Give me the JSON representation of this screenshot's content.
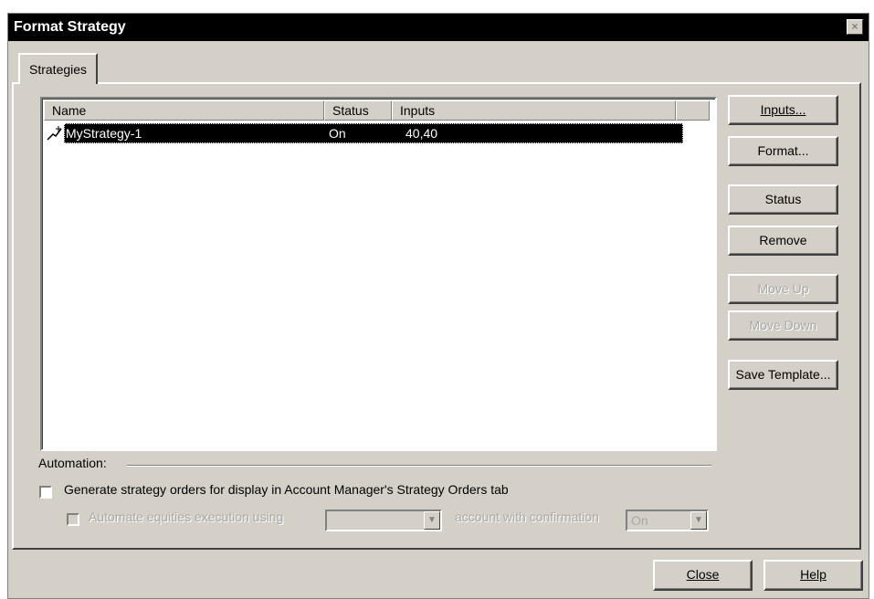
{
  "window": {
    "title": "Format Strategy",
    "close_glyph": "×"
  },
  "tabs": [
    {
      "label": "Strategies"
    }
  ],
  "list": {
    "columns": [
      "Name",
      "Status",
      "Inputs"
    ],
    "rows": [
      {
        "icon": "strategy-icon",
        "name": "MyStrategy-1",
        "status": "On",
        "inputs": "40,40"
      }
    ]
  },
  "buttons": {
    "inputs": "Inputs...",
    "format": "Format...",
    "status": "Status",
    "remove": "Remove",
    "move_up": "Move Up",
    "move_down": "Move Down",
    "save_template": "Save Template..."
  },
  "automation": {
    "label": "Automation:",
    "generate_orders": "Generate strategy orders for display in Account Manager's Strategy Orders tab",
    "automate_prefix": "Automate equities execution using",
    "account_select_value": "",
    "confirmation_text": "account with confirmation",
    "confirmation_value": "On"
  },
  "footer": {
    "close": "Close",
    "help": "Help"
  },
  "colors": {
    "face": "#d4d0c8",
    "title_bg": "#000000",
    "selection": "#000000"
  }
}
